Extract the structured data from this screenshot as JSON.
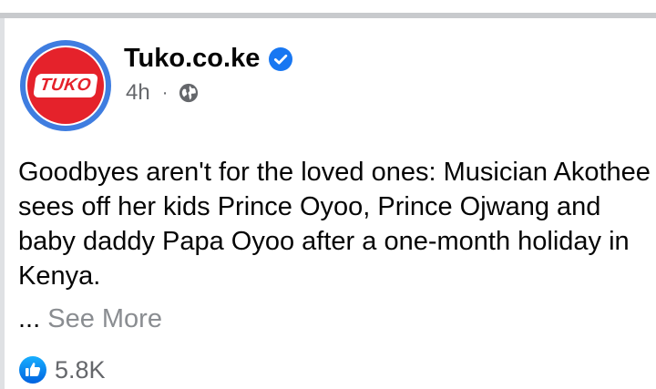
{
  "post": {
    "page_name": "Tuko.co.ke",
    "avatar_text": "TUKO",
    "timestamp": "4h",
    "separator": "·",
    "body_text": "Goodbyes aren't for the loved ones: Musician Akothee sees off her kids Prince Oyoo, Prince Ojwang and baby daddy Papa Oyoo after a one-month holiday in Kenya.",
    "ellipsis": "...",
    "see_more_label": "See More",
    "like_count": "5.8K",
    "icons": {
      "verified": "verified-badge-icon",
      "audience": "globe-icon",
      "reaction": "like-icon"
    },
    "colors": {
      "brand_red": "#e5222b",
      "facebook_blue": "#1877f2",
      "avatar_ring": "#3f7de0",
      "text_primary": "#050505",
      "text_secondary": "#65676b",
      "see_more": "#8a8d91"
    }
  }
}
